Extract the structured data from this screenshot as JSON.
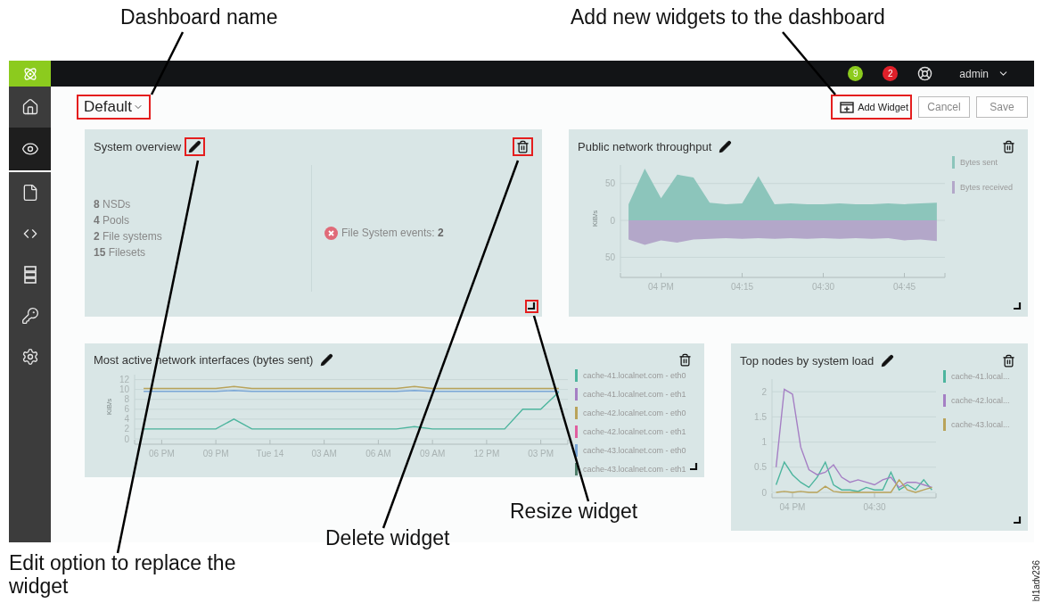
{
  "callouts": [
    {
      "text": "Dashboard name"
    },
    {
      "text": "Add new widgets to the dashboard"
    },
    {
      "text": "Edit option to replace the widget"
    },
    {
      "text": "Delete widget"
    },
    {
      "text": "Resize widget"
    }
  ],
  "figure_id": "bl1adv236",
  "sidebar": {
    "items": [
      {
        "selected": false
      },
      {
        "selected": true
      },
      {
        "selected": false
      },
      {
        "selected": false
      },
      {
        "selected": false
      },
      {
        "selected": false
      },
      {
        "selected": false
      }
    ]
  },
  "topbar": {
    "badges": [
      {
        "text": "9",
        "color": "#8ccb1e"
      },
      {
        "text": "2",
        "color": "#e0202a"
      }
    ],
    "user": "admin"
  },
  "dashboard": {
    "name": "Default",
    "highlighted": true
  },
  "actions": {
    "add": {
      "label": "Add Widget",
      "highlighted": true
    },
    "buttons": [
      "Cancel",
      "Save"
    ]
  },
  "widgets": [
    {
      "kind": "overview",
      "title": "System overview",
      "edit_highlighted": true,
      "delete_highlighted": true,
      "resize_highlighted": true,
      "stats": [
        "**8** NSDs",
        "**4** Pools",
        "**2** File systems",
        "**15** Filesets"
      ],
      "event": "File System events: **2**"
    },
    {
      "kind": "chart",
      "title": "Public network throughput",
      "edit_highlighted": false,
      "delete_highlighted": false,
      "resize_highlighted": false,
      "chart_data": {
        "type": "area",
        "ylabel": "KiB/s",
        "grid": true,
        "ylim": [
          -70,
          75
        ],
        "categories": [
          null,
          null,
          "04 PM",
          null,
          null,
          null,
          null,
          "04:15",
          null,
          null,
          null,
          null,
          "04:30",
          null,
          null,
          null,
          null,
          "04:45",
          null,
          null
        ],
        "yticks": [
          {
            "value": 50,
            "label": "50"
          },
          {
            "value": 0,
            "label": "0"
          },
          {
            "value": -50,
            "label": "50"
          }
        ],
        "series": [
          {
            "name": "Bytes sent",
            "color": "#8cc5bb",
            "values": [
              22,
              70,
              30,
              62,
              58,
              24,
              22,
              23,
              60,
              22,
              23,
              22,
              22,
              23,
              22,
              22,
              23,
              22,
              23,
              24
            ]
          },
          {
            "name": "Bytes received",
            "color": "#b3a7c9",
            "values": [
              -26,
              -33,
              -27,
              -30,
              -26,
              -25,
              -24,
              -25,
              -24,
              -25,
              -24,
              -25,
              -24,
              -25,
              -24,
              -25,
              -24,
              -27,
              -26,
              -28
            ]
          }
        ]
      }
    },
    {
      "kind": "chart",
      "title": "Most active network interfaces (bytes sent)",
      "edit_highlighted": false,
      "delete_highlighted": false,
      "resize_highlighted": false,
      "chart_data": {
        "type": "line",
        "ylabel": "KiB/s",
        "grid": true,
        "ylim": [
          0,
          13
        ],
        "categories": [
          null,
          "06 PM",
          null,
          null,
          "09 PM",
          null,
          null,
          "Tue 14",
          null,
          null,
          "03 AM",
          null,
          null,
          "06 AM",
          null,
          null,
          "09 AM",
          null,
          null,
          "12 PM",
          null,
          null,
          "03 PM",
          null
        ],
        "yticks": [
          0,
          2,
          4,
          6,
          8,
          10,
          12
        ],
        "series": [
          {
            "name": "cache-41.localnet.com - eth0",
            "color": "#4db59e",
            "values": [
              2,
              2,
              2,
              2,
              2,
              4,
              2,
              2,
              2,
              2,
              2,
              2,
              2,
              2,
              2,
              2.5,
              2,
              2,
              2,
              2,
              2,
              6,
              6,
              9.5
            ]
          },
          {
            "name": "cache-41.localnet.com - eth1",
            "color": "#a57fc4",
            "values": [
              null,
              null,
              null,
              null,
              null,
              null,
              null,
              null,
              null,
              null,
              null,
              null,
              null,
              null,
              null,
              null,
              null,
              null,
              null,
              null,
              null,
              null,
              null,
              null
            ]
          },
          {
            "name": "cache-42.localnet.com - eth0",
            "color": "#b9a35a",
            "values": [
              10.2,
              10.2,
              10.2,
              10.2,
              10.2,
              10.6,
              10.2,
              10.2,
              10.2,
              10.2,
              10.2,
              10.2,
              10.2,
              10.2,
              10.2,
              10.6,
              10.2,
              10.2,
              10.2,
              10.2,
              10.2,
              10.2,
              10.2,
              10.2
            ]
          },
          {
            "name": "cache-42.localnet.com - eth1",
            "color": "#e05fa0",
            "values": [
              null,
              null,
              null,
              null,
              null,
              null,
              null,
              null,
              null,
              null,
              null,
              null,
              null,
              null,
              null,
              null,
              null,
              null,
              null,
              null,
              null,
              null,
              null,
              null
            ]
          },
          {
            "name": "cache-43.localnet.com - eth0",
            "color": "#7aa6d6",
            "values": [
              9.6,
              9.6,
              9.6,
              9.6,
              9.6,
              9.8,
              9.6,
              9.6,
              9.6,
              9.6,
              9.6,
              9.6,
              9.6,
              9.6,
              9.6,
              9.8,
              9.6,
              9.6,
              9.6,
              9.6,
              9.6,
              9.6,
              9.6,
              9.6
            ]
          },
          {
            "name": "cache-43.localnet.com - eth1",
            "color": "#4f7f6a",
            "values": [
              null,
              null,
              null,
              null,
              null,
              null,
              null,
              null,
              null,
              null,
              null,
              null,
              null,
              null,
              null,
              null,
              null,
              null,
              null,
              null,
              null,
              null,
              null,
              null
            ]
          }
        ]
      }
    },
    {
      "kind": "chart",
      "title": "Top nodes by system load",
      "edit_highlighted": false,
      "delete_highlighted": false,
      "resize_highlighted": false,
      "chart_data": {
        "type": "line",
        "grid": true,
        "ylim": [
          0,
          2.25
        ],
        "categories": [
          null,
          null,
          "04 PM",
          null,
          null,
          null,
          null,
          null,
          null,
          null,
          null,
          null,
          "04:30",
          null,
          null,
          null,
          null,
          null,
          null,
          null
        ],
        "yticks": [
          0,
          0.5,
          1,
          1.5,
          2
        ],
        "series": [
          {
            "name": "cache-41.local...",
            "color": "#4db59e",
            "values": [
              0.15,
              0.6,
              0.35,
              0.2,
              0.1,
              0.3,
              0.6,
              0.15,
              0.05,
              0.05,
              0.02,
              0.1,
              0.05,
              0.05,
              0.4,
              0.05,
              0.15,
              0.05,
              0.25,
              0.05
            ]
          },
          {
            "name": "cache-42.local...",
            "color": "#a57fc4",
            "values": [
              0.5,
              2.05,
              1.95,
              0.9,
              0.45,
              0.35,
              0.4,
              0.55,
              0.3,
              0.2,
              0.25,
              0.2,
              0.15,
              0.25,
              0.3,
              0.1,
              0.2,
              0.2,
              0.15,
              0.1
            ]
          },
          {
            "name": "cache-43.local...",
            "color": "#b9a35a",
            "values": [
              0,
              0.02,
              0,
              0.02,
              0,
              0,
              0.12,
              0.02,
              0,
              0,
              0,
              0,
              0,
              0,
              0,
              0.25,
              0.05,
              0,
              0.05,
              0.1
            ]
          }
        ]
      }
    }
  ]
}
